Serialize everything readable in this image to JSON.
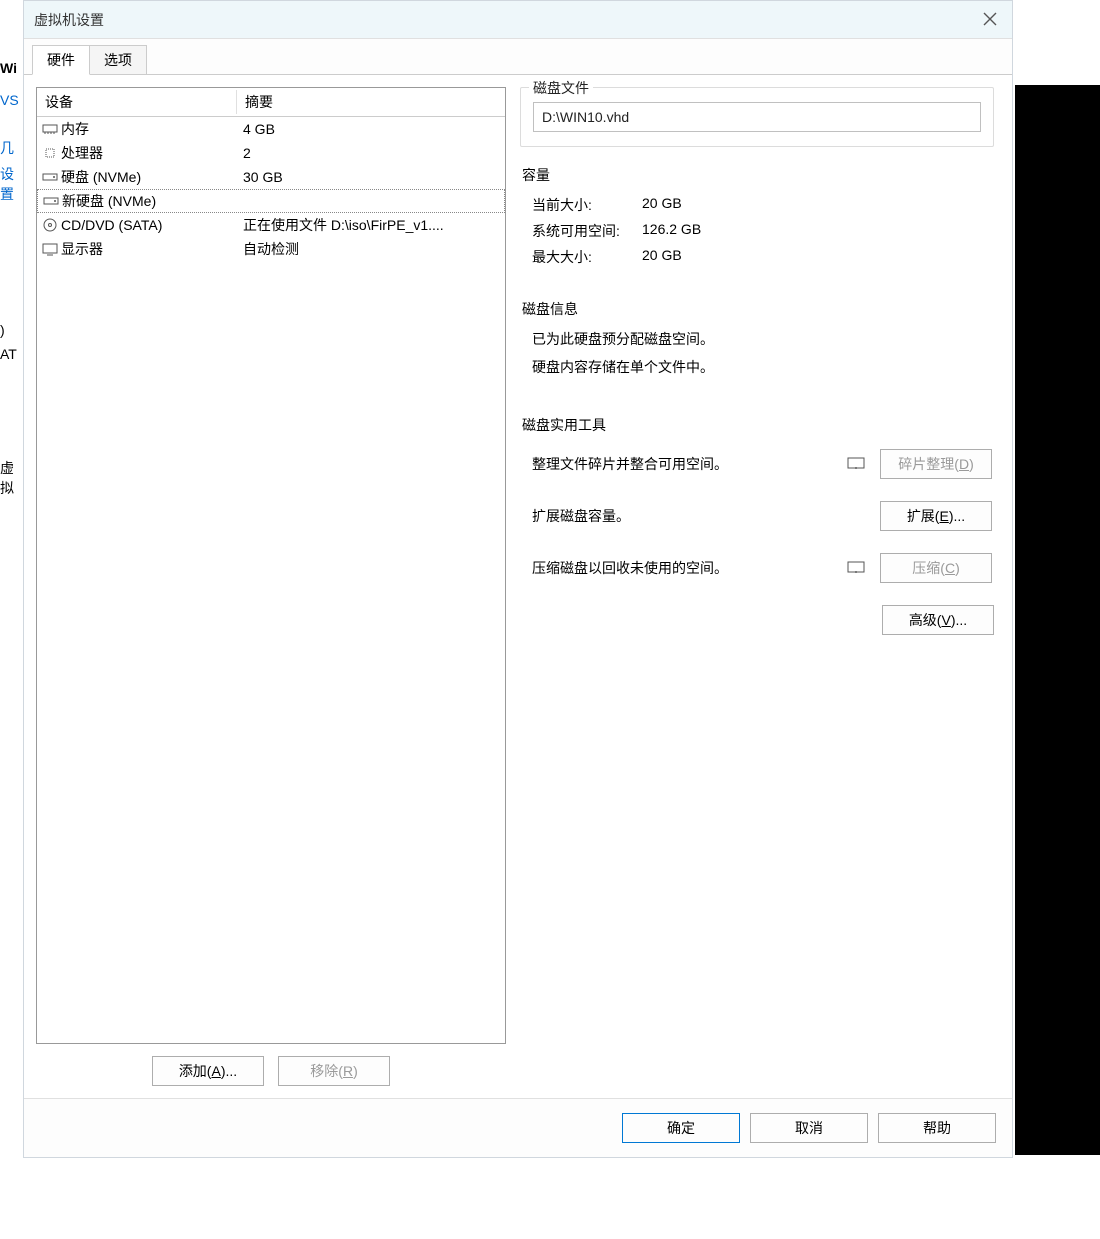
{
  "backdrop": {
    "frag1": "Wi",
    "frag2": "VS",
    "frag3": "几",
    "frag4": "设置",
    "frag5": ")",
    "frag6": "AT",
    "frag7": "虚拟"
  },
  "title": "虚拟机设置",
  "tabs": {
    "hardware": "硬件",
    "options": "选项"
  },
  "deviceTable": {
    "headDev": "设备",
    "headSum": "摘要",
    "rows": [
      {
        "icon": "memory-icon",
        "dev": "内存",
        "sum": "4 GB"
      },
      {
        "icon": "cpu-icon",
        "dev": "处理器",
        "sum": "2"
      },
      {
        "icon": "disk-icon",
        "dev": "硬盘 (NVMe)",
        "sum": "30 GB"
      },
      {
        "icon": "disk-icon",
        "dev": "新硬盘 (NVMe)",
        "sum": "",
        "selected": true
      },
      {
        "icon": "cd-icon",
        "dev": "CD/DVD (SATA)",
        "sum": "正在使用文件 D:\\iso\\FirPE_v1...."
      },
      {
        "icon": "display-icon",
        "dev": "显示器",
        "sum": "自动检测"
      }
    ]
  },
  "leftButtons": {
    "add": "添加(A)...",
    "remove": "移除(R)"
  },
  "right": {
    "diskFile": {
      "label": "磁盘文件",
      "value": "D:\\WIN10.vhd"
    },
    "capacity": {
      "label": "容量",
      "curK": "当前大小:",
      "curV": "20 GB",
      "freeK": "系统可用空间:",
      "freeV": "126.2 GB",
      "maxK": "最大大小:",
      "maxV": "20 GB"
    },
    "diskInfo": {
      "label": "磁盘信息",
      "line1": "已为此硬盘预分配磁盘空间。",
      "line2": "硬盘内容存储在单个文件中。"
    },
    "utils": {
      "label": "磁盘实用工具",
      "defragTxt": "整理文件碎片并整合可用空间。",
      "defragBtn": "碎片整理(D)",
      "expandTxt": "扩展磁盘容量。",
      "expandBtn": "扩展(E)...",
      "compactTxt": "压缩磁盘以回收未使用的空间。",
      "compactBtn": "压缩(C)"
    },
    "advanced": "高级(V)..."
  },
  "dialogButtons": {
    "ok": "确定",
    "cancel": "取消",
    "help": "帮助"
  }
}
